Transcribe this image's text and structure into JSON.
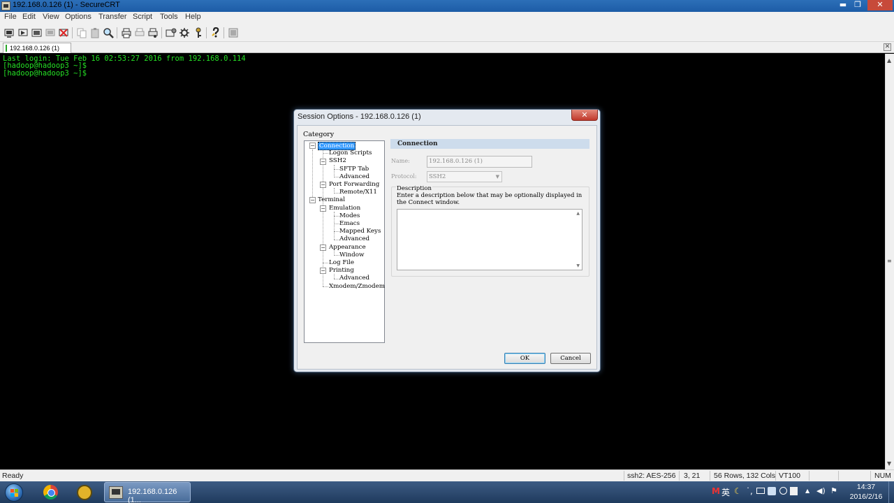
{
  "window": {
    "title": "192.168.0.126 (1) - SecureCRT",
    "min_glyph": "▬",
    "max_glyph": "❐",
    "close_glyph": "✕"
  },
  "menu": [
    "File",
    "Edit",
    "View",
    "Options",
    "Transfer",
    "Script",
    "Tools",
    "Help"
  ],
  "toolbar_icons": [
    "connect-icon",
    "quick-connect-icon",
    "connect-tab-icon",
    "reconnect-icon",
    "disconnect-icon",
    "copy-icon",
    "paste-icon",
    "find-icon",
    "print-icon",
    "print-selection-icon",
    "print-setup-icon",
    "session-options-icon",
    "global-options-icon",
    "keymap-icon",
    "help-icon",
    "sftp-icon"
  ],
  "tab": {
    "label": "192.168.0.126  (1)",
    "close_glyph": "✕"
  },
  "terminal": {
    "lines": [
      "Last login: Tue Feb 16 02:53:27 2016 from 192.168.0.114",
      "[hadoop@hadoop3 ~]$",
      "[hadoop@hadoop3 ~]$"
    ],
    "text_color": "#25e025",
    "scroll_up": "▲",
    "scroll_mid": "≡",
    "scroll_down": "▼"
  },
  "status": {
    "ready": "Ready",
    "cipher": "ssh2: AES-256",
    "cursor": "3,  21",
    "size": "56 Rows, 132 Cols",
    "emulation": "VT100",
    "num": "NUM"
  },
  "taskbar": {
    "active_window": "192.168.0.126 (1...",
    "tray": {
      "m": "M",
      "ime": "英",
      "moon": "☾",
      "dot": "˙,",
      "up_arrow": "▲",
      "volume": "◀)",
      "flag": "⚑"
    },
    "time": "14:37",
    "date": "2016/2/16"
  },
  "dialog": {
    "title": "Session Options - 192.168.0.126 (1)",
    "close_glyph": "✕",
    "category_label": "Category",
    "tree": [
      {
        "label": "Connection",
        "selected": true
      },
      {
        "label": "Logon Scripts"
      },
      {
        "label": "SSH2"
      },
      {
        "label": "SFTP Tab"
      },
      {
        "label": "Advanced"
      },
      {
        "label": "Port Forwarding"
      },
      {
        "label": "Remote/X11"
      },
      {
        "label": "Terminal"
      },
      {
        "label": "Emulation"
      },
      {
        "label": "Modes"
      },
      {
        "label": "Emacs"
      },
      {
        "label": "Mapped Keys"
      },
      {
        "label": "Advanced"
      },
      {
        "label": "Appearance"
      },
      {
        "label": "Window"
      },
      {
        "label": "Log File"
      },
      {
        "label": "Printing"
      },
      {
        "label": "Advanced"
      },
      {
        "label": "Xmodem/Zmodem"
      }
    ],
    "expander": "−",
    "section_title": "Connection",
    "name_label": "Name:",
    "name_value": "192.168.0.126  (1)",
    "protocol_label": "Protocol:",
    "protocol_value": "SSH2",
    "protocol_caret": "▼",
    "description_label": "Description",
    "description_help": "Enter a description below that may be optionally displayed in the Connect window.",
    "desc_up": "▲",
    "desc_down": "▼",
    "ok_label": "OK",
    "cancel_label": "Cancel"
  }
}
